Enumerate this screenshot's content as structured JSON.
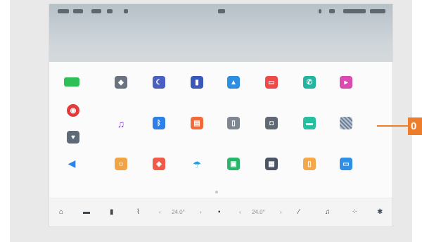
{
  "status_bar": {
    "center_icon": "media-icon"
  },
  "apps": [
    {
      "name": "green-app",
      "label": "",
      "color": "#2fbf57",
      "glyph": ""
    },
    {
      "name": "photo-app",
      "label": "",
      "color": "#6b7280",
      "glyph": "◆"
    },
    {
      "name": "night-app",
      "label": "",
      "color": "#4b5fc2",
      "glyph": "☾"
    },
    {
      "name": "book-app",
      "label": "",
      "color": "#3a58b8",
      "glyph": "▮"
    },
    {
      "name": "gallery-app",
      "label": "",
      "color": "#2e8fe0",
      "glyph": "▲"
    },
    {
      "name": "red-app",
      "label": "",
      "color": "#ef4a4a",
      "glyph": "▭"
    },
    {
      "name": "phone-app",
      "label": "",
      "color": "#22b5a0",
      "glyph": "✆"
    },
    {
      "name": "pink-app",
      "label": "",
      "color": "#d94bb0",
      "glyph": "▸"
    },
    {
      "name": "netease-music-app",
      "label": "",
      "color": "#e33b3b",
      "glyph": "◉"
    },
    {
      "name": "music-app",
      "label": "",
      "color": "#ffffff",
      "glyph": "♫"
    },
    {
      "name": "bluetooth-app",
      "label": "",
      "color": "#2e7fe8",
      "glyph": "ᛒ"
    },
    {
      "name": "orange-app",
      "label": "",
      "color": "#f06a3c",
      "glyph": "▤"
    },
    {
      "name": "document-app",
      "label": "",
      "color": "#7e8791",
      "glyph": "▯"
    },
    {
      "name": "dashcam-app",
      "label": "",
      "color": "#5f6873",
      "glyph": "◘"
    },
    {
      "name": "message-app",
      "label": "",
      "color": "#26c0a0",
      "glyph": "▬"
    },
    {
      "name": "pattern-app",
      "label": "",
      "color": "#7d8ea3",
      "glyph": "▦"
    },
    {
      "name": "heart-app",
      "label": "",
      "color": "#5e6a76",
      "glyph": "♥"
    },
    {
      "name": "navigation-app",
      "label": "",
      "color": "#ffffff",
      "glyph": "◀"
    },
    {
      "name": "contacts-app",
      "label": "",
      "color": "#f2a343",
      "glyph": "☺"
    },
    {
      "name": "vpn-app",
      "label": "",
      "color": "#f05a4a",
      "glyph": "◈"
    },
    {
      "name": "umbrella-app",
      "label": "",
      "color": "#ffffff",
      "glyph": "☂"
    },
    {
      "name": "shop-app",
      "label": "",
      "color": "#29b56a",
      "glyph": "▣"
    },
    {
      "name": "calculator-app",
      "label": "",
      "color": "#4b5563",
      "glyph": "▦"
    },
    {
      "name": "notes-app",
      "label": "",
      "color": "#f3a94b",
      "glyph": "▯"
    },
    {
      "name": "tv-app",
      "label": "",
      "color": "#2f8fe5",
      "glyph": "▭"
    }
  ],
  "dock": {
    "temp_left": "24.0°",
    "temp_right": "24.0°"
  },
  "callout": {
    "number": "0",
    "color": "#ee7d2b"
  }
}
